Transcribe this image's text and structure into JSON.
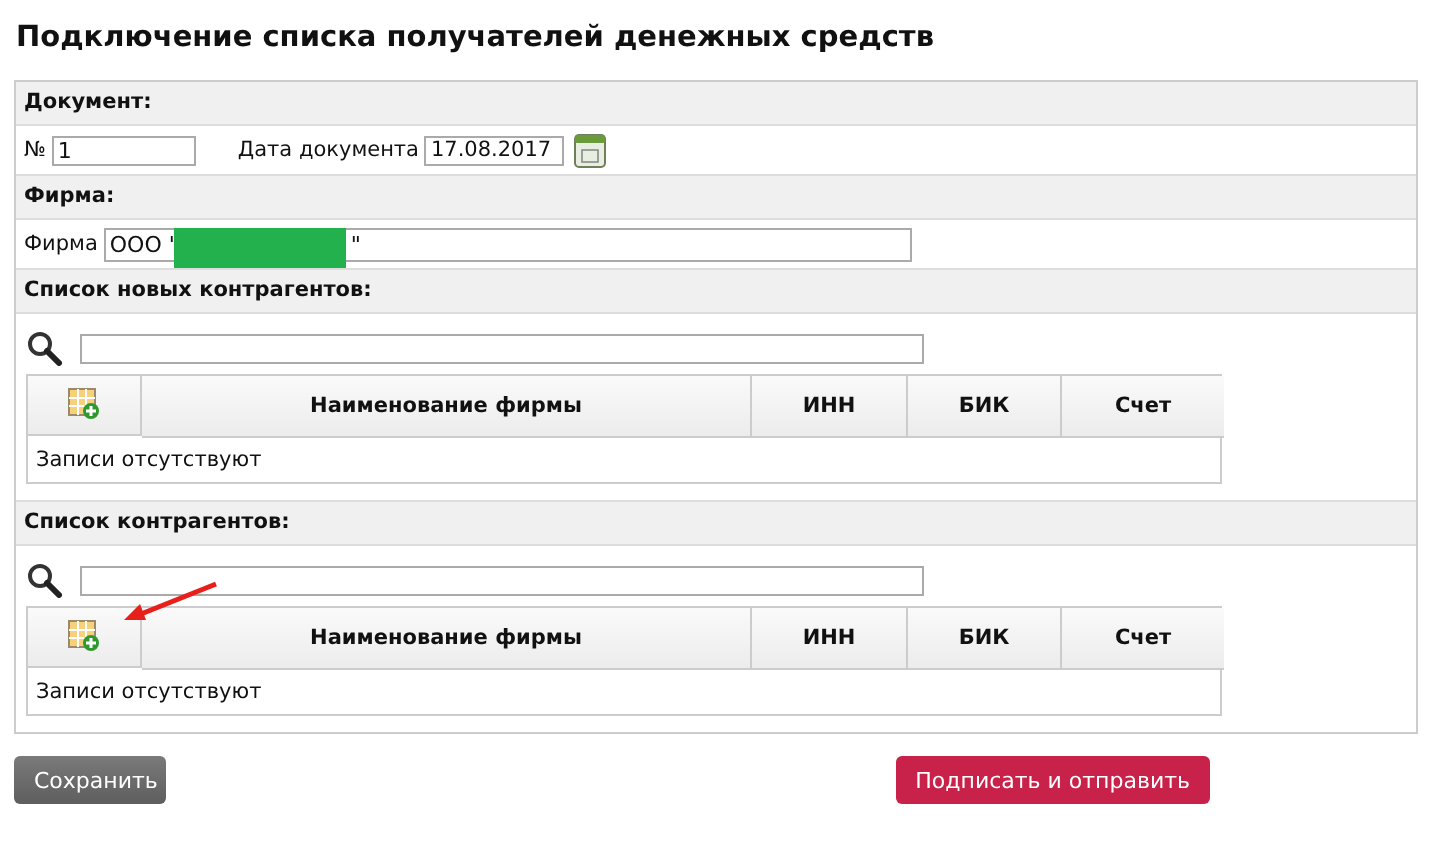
{
  "title": "Подключение списка получателей денежных средств",
  "document": {
    "header": "Документ:",
    "number_label": "№",
    "number_value": "1",
    "date_label": "Дата документа",
    "date_value": "17.08.2017"
  },
  "firm": {
    "header": "Фирма:",
    "label": "Фирма",
    "value_parts": [
      "ООО \"",
      "\""
    ],
    "redacted": true
  },
  "lists": [
    {
      "header": "Список новых контрагентов:",
      "columns": [
        "Наименование фирмы",
        "ИНН",
        "БИК",
        "Счет"
      ],
      "empty_text": "Записи отсутствуют"
    },
    {
      "header": "Список контрагентов:",
      "arrow_mark": true,
      "columns": [
        "Наименование фирмы",
        "ИНН",
        "БИК",
        "Счет"
      ],
      "empty_text": "Записи отсутствуют"
    }
  ],
  "buttons": [
    {
      "label": "Сохранить",
      "kind": "secondary"
    },
    {
      "label": "Подписать и отправить",
      "kind": "primary"
    }
  ]
}
